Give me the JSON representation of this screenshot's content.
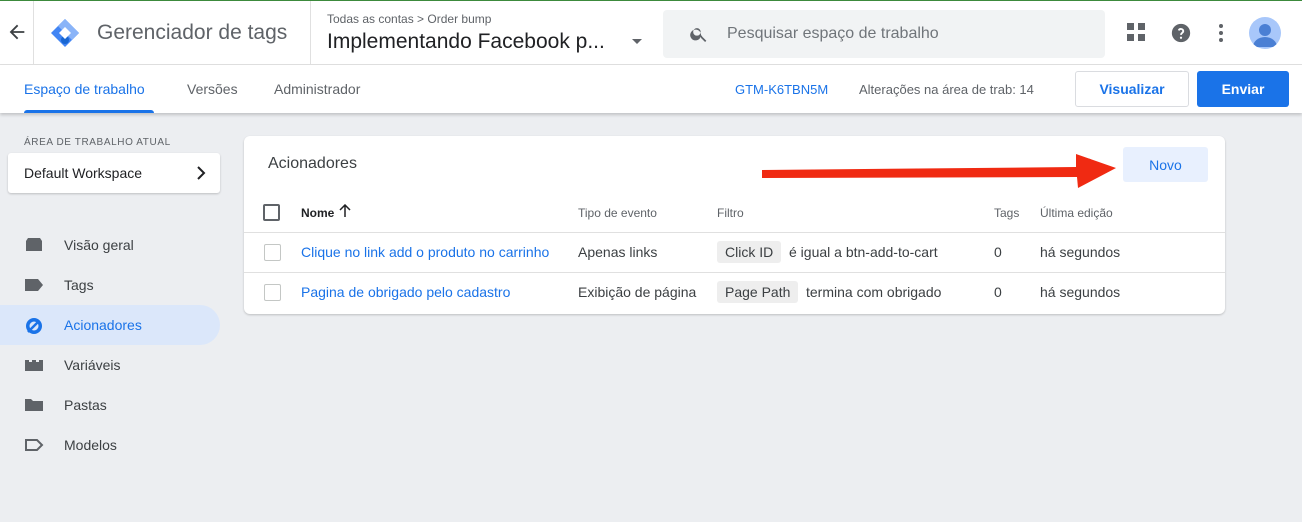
{
  "header": {
    "app_title": "Gerenciador de tags",
    "breadcrumb": "Todas as contas  >  Order bump",
    "container_name": "Implementando Facebook p...",
    "search_placeholder": "Pesquisar espaço de trabalho",
    "icons": [
      "back-arrow-icon",
      "gtm-logo",
      "search-icon",
      "apps-grid-icon",
      "help-icon",
      "more-vert-icon",
      "account-avatar"
    ]
  },
  "nav": {
    "tabs": [
      {
        "label": "Espaço de trabalho",
        "active": true
      },
      {
        "label": "Versões",
        "active": false
      },
      {
        "label": "Administrador",
        "active": false
      }
    ],
    "container_id": "GTM-K6TBN5M",
    "changes": "Alterações na área de trab: 14",
    "preview_label": "Visualizar",
    "submit_label": "Enviar"
  },
  "sidebar": {
    "workspace_label": "ÁREA DE TRABALHO ATUAL",
    "workspace_name": "Default Workspace",
    "items": [
      {
        "label": "Visão geral",
        "icon": "overview-icon",
        "active": false
      },
      {
        "label": "Tags",
        "icon": "tag-icon",
        "active": false
      },
      {
        "label": "Acionadores",
        "icon": "trigger-icon",
        "active": true
      },
      {
        "label": "Variáveis",
        "icon": "variables-icon",
        "active": false
      },
      {
        "label": "Pastas",
        "icon": "folder-icon",
        "active": false
      },
      {
        "label": "Modelos",
        "icon": "template-icon",
        "active": false
      }
    ]
  },
  "triggers": {
    "title": "Acionadores",
    "new_label": "Novo",
    "columns": [
      "Nome",
      "Tipo de evento",
      "Filtro",
      "Tags",
      "Última edição"
    ],
    "rows": [
      {
        "name": "Clique no link add o produto no carrinho",
        "event_type": "Apenas links",
        "filter_variable": "Click ID",
        "filter_condition": "é igual a btn-add-to-cart",
        "tags": "0",
        "last_edited": "há segundos"
      },
      {
        "name": "Pagina de obrigado pelo cadastro",
        "event_type": "Exibição de página",
        "filter_variable": "Page Path",
        "filter_condition": "termina com obrigado",
        "tags": "0",
        "last_edited": "há segundos"
      }
    ]
  },
  "colors": {
    "accent": "#1a73e8",
    "active_nav_bg": "#dbe7fa",
    "annotation_arrow": "#f02a12"
  }
}
